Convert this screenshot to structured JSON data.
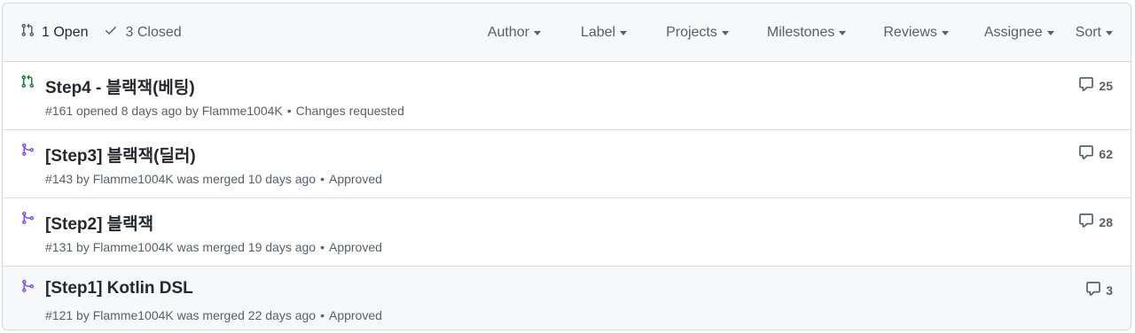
{
  "header": {
    "open_label": "1 Open",
    "closed_label": "3 Closed",
    "filters": [
      "Author",
      "Label",
      "Projects",
      "Milestones",
      "Reviews",
      "Assignee",
      "Sort"
    ]
  },
  "colors": {
    "open_icon": "#1a7f37",
    "merged_icon": "#8250df",
    "muted": "#57606a"
  },
  "pull_requests": [
    {
      "status": "open",
      "title": "Step4 - 블랙잭(베팅)",
      "number_line": "#161 opened 8 days ago by Flamme1004K",
      "review": "Changes requested",
      "comments": "25"
    },
    {
      "status": "merged",
      "title": "[Step3] 블랙잭(딜러)",
      "number_line": "#143 by Flamme1004K was merged 10 days ago",
      "review": "Approved",
      "comments": "62"
    },
    {
      "status": "merged",
      "title": "[Step2] 블랙잭",
      "number_line": "#131 by Flamme1004K was merged 19 days ago",
      "review": "Approved",
      "comments": "28"
    },
    {
      "status": "merged",
      "title": "[Step1] Kotlin DSL",
      "number_line": "#121 by Flamme1004K was merged 22 days ago",
      "review": "Approved",
      "comments": "3"
    }
  ]
}
